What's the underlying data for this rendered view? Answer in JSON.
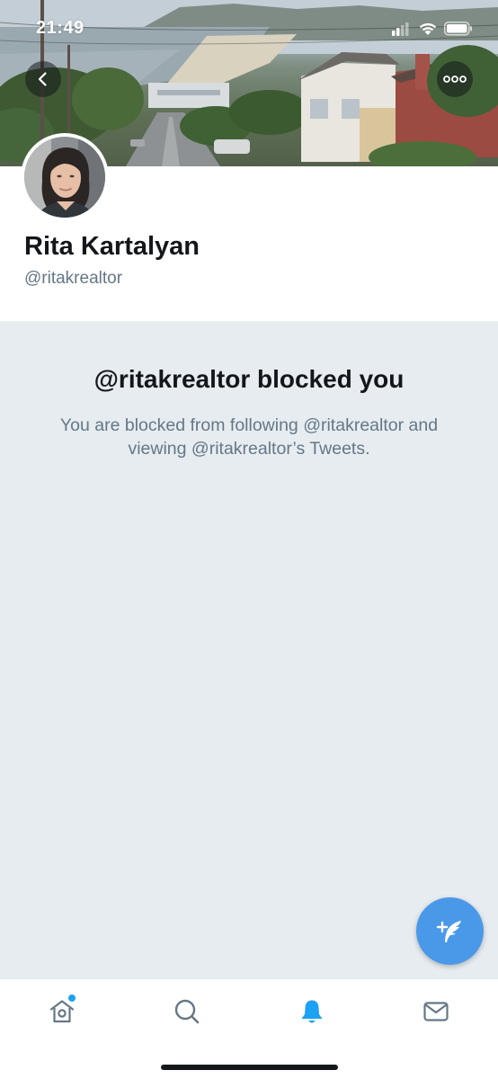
{
  "status_bar": {
    "time": "21:49"
  },
  "profile": {
    "display_name": "Rita Kartalyan",
    "handle": "@ritakrealtor"
  },
  "blocked_notice": {
    "title": "@ritakrealtor blocked you",
    "message": "You are blocked from following @ritakrealtor and viewing @ritakrealtor’s Tweets."
  },
  "tab_bar": {
    "items": [
      {
        "icon": "home-icon",
        "active": false,
        "has_unread_dot": true
      },
      {
        "icon": "search-icon",
        "active": false,
        "has_unread_dot": false
      },
      {
        "icon": "bell-icon",
        "active": true,
        "has_unread_dot": false
      },
      {
        "icon": "mail-icon",
        "active": false,
        "has_unread_dot": false
      }
    ]
  },
  "colors": {
    "accent": "#1da1f2",
    "fab": "#4a99e9",
    "panel_background": "#e6ecf0",
    "secondary_text": "#657786",
    "primary_text": "#14171a"
  }
}
